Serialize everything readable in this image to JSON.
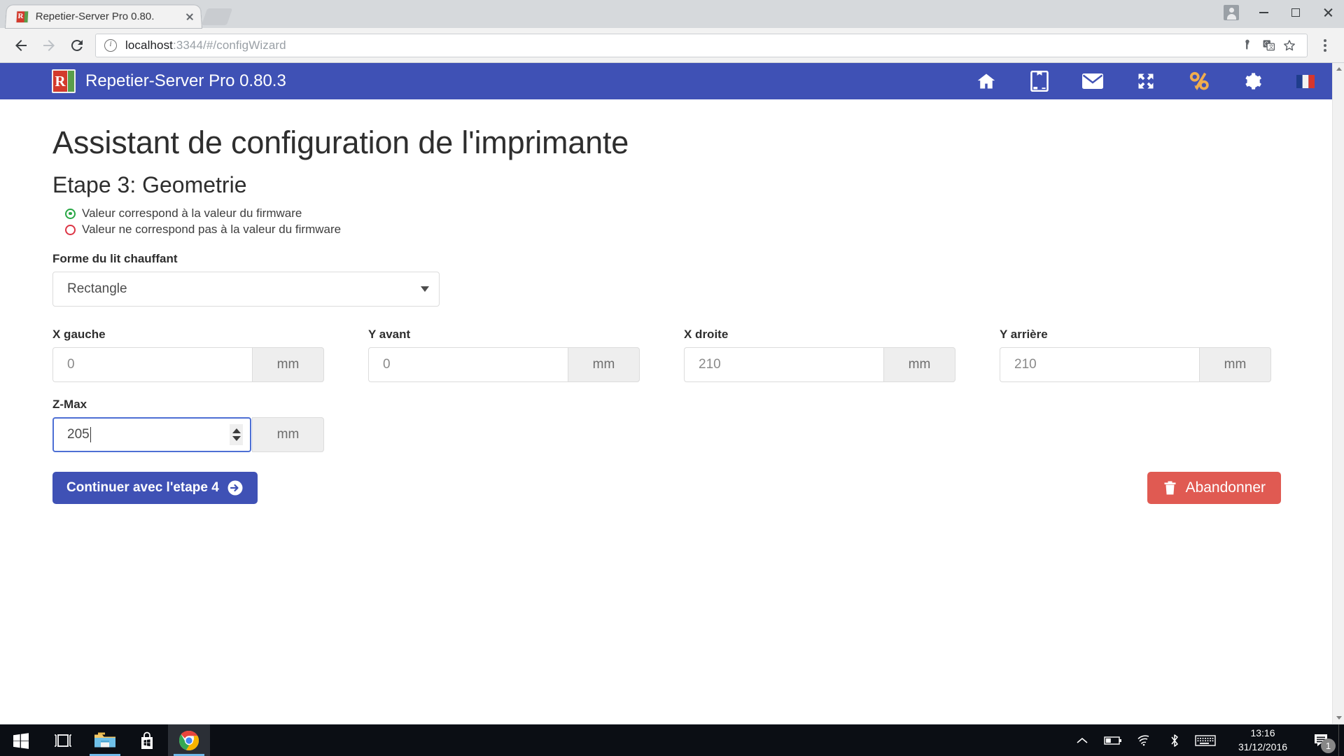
{
  "browser": {
    "tab_title": "Repetier-Server Pro 0.80.",
    "url_host": "localhost",
    "url_path": ":3344/#/configWizard",
    "favicon_letter": "R"
  },
  "app": {
    "brand_letter": "R",
    "brand_title": "Repetier-Server Pro 0.80.3",
    "nav_icons": [
      {
        "name": "home-icon"
      },
      {
        "name": "manual-icon"
      },
      {
        "name": "mail-icon"
      },
      {
        "name": "fullscreen-icon"
      },
      {
        "name": "percent-icon"
      },
      {
        "name": "settings-gear-icon"
      },
      {
        "name": "language-flag-icon"
      }
    ]
  },
  "wizard": {
    "page_title": "Assistant de configuration de l'imprimante",
    "step_title": "Etape 3: Geometrie",
    "legend": [
      {
        "text": "Valeur correspond à la valeur du firmware",
        "state": "ok"
      },
      {
        "text": "Valeur ne correspond pas à la valeur du firmware",
        "state": "mismatch"
      }
    ],
    "bed_shape_label": "Forme du lit chauffant",
    "bed_shape_value": "Rectangle",
    "fields": [
      {
        "label": "X gauche",
        "value": "0",
        "unit": "mm",
        "focused": false
      },
      {
        "label": "Y avant",
        "value": "0",
        "unit": "mm",
        "focused": false
      },
      {
        "label": "X droite",
        "value": "210",
        "unit": "mm",
        "focused": false
      },
      {
        "label": "Y arrière",
        "value": "210",
        "unit": "mm",
        "focused": false
      }
    ],
    "zmax": {
      "label": "Z-Max",
      "value": "205",
      "unit": "mm",
      "focused": true
    },
    "continue_label": "Continuer avec l'etape 4",
    "abort_label": "Abandonner"
  },
  "colors": {
    "primary": "#3f51b5",
    "danger": "#e05a52",
    "ok": "#28a745",
    "mismatch": "#dc3545",
    "percent_icon": "#f0ad4e"
  },
  "taskbar": {
    "items": [
      {
        "name": "start-button"
      },
      {
        "name": "task-view-button"
      },
      {
        "name": "file-explorer-button"
      },
      {
        "name": "microsoft-store-button"
      },
      {
        "name": "chrome-button"
      }
    ],
    "tray": [
      {
        "name": "show-hidden-icons-button"
      },
      {
        "name": "battery-icon"
      },
      {
        "name": "wifi-icon"
      },
      {
        "name": "bluetooth-icon"
      },
      {
        "name": "keyboard-icon"
      }
    ],
    "clock_time": "13:16",
    "clock_date": "31/12/2016",
    "notification_count": "1"
  }
}
